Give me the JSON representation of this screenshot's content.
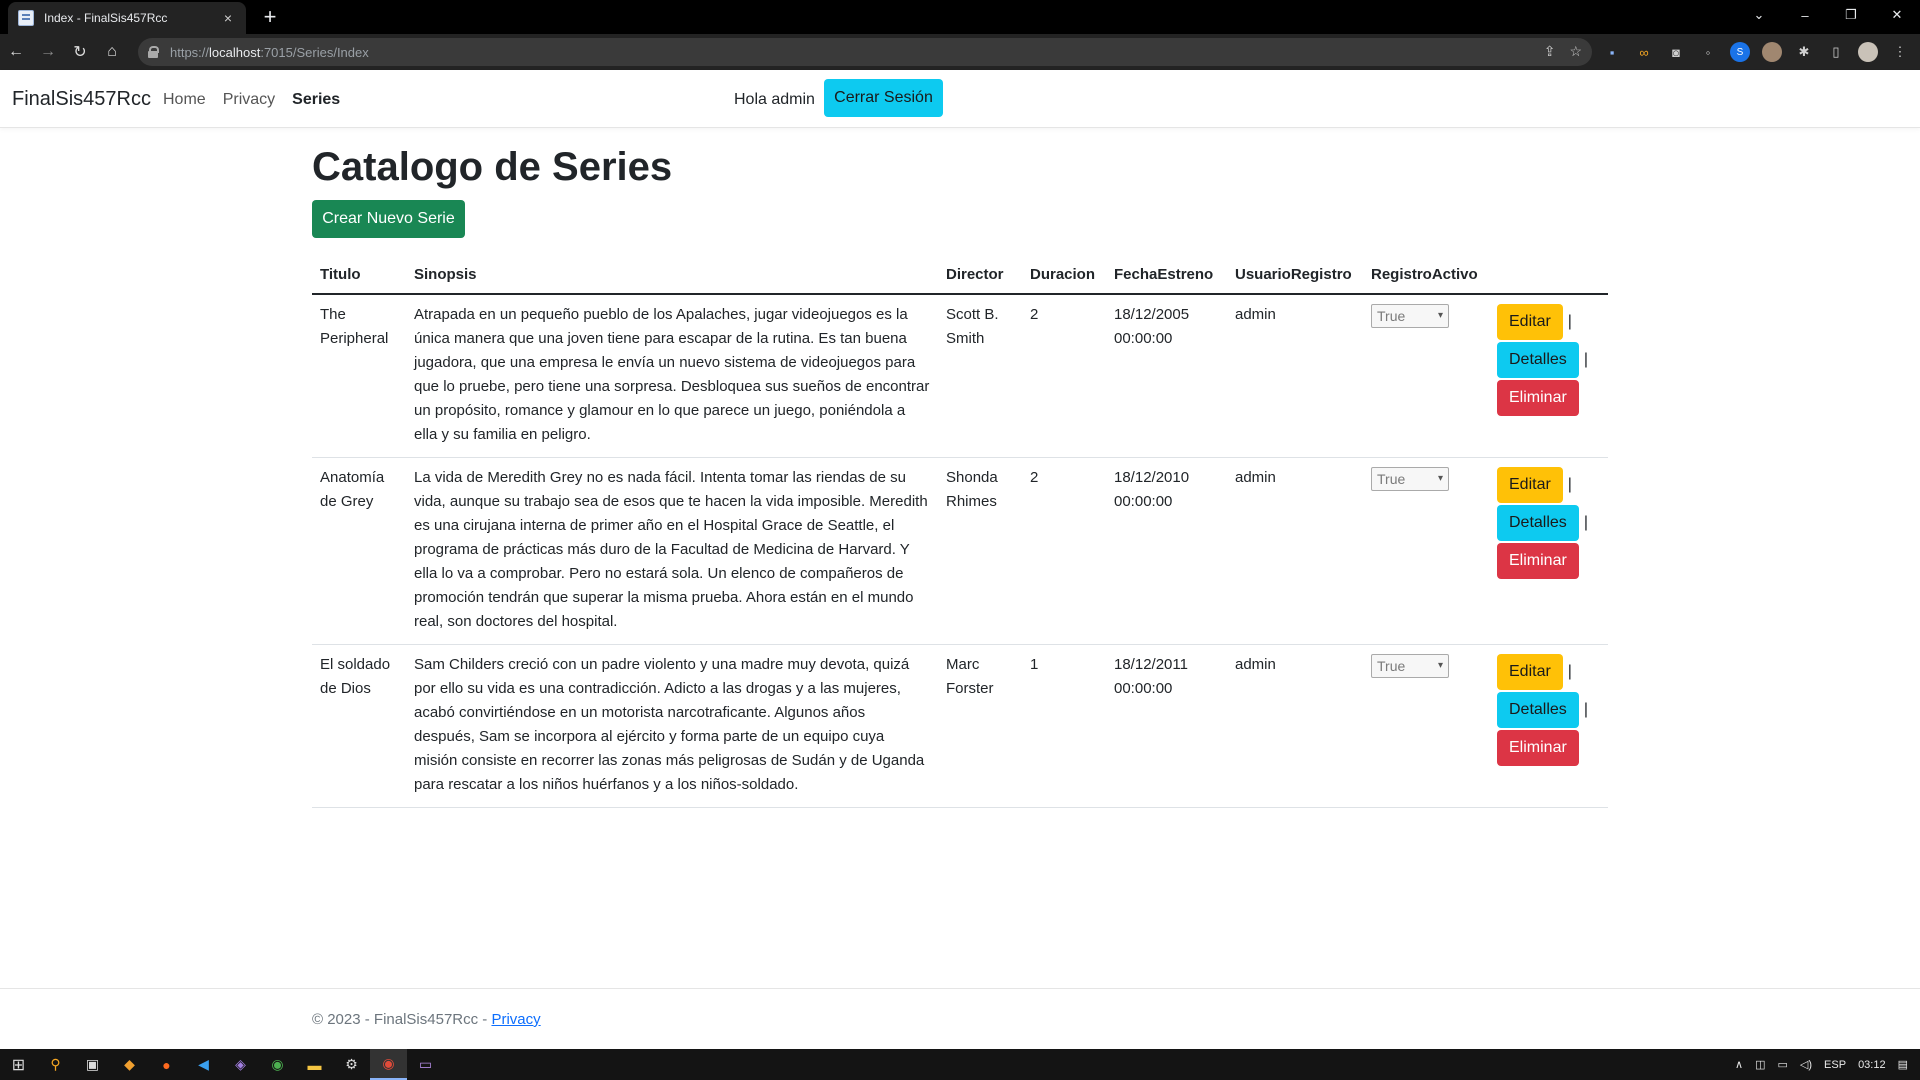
{
  "browser": {
    "tab_title": "Index - FinalSis457Rcc",
    "tab_close": "×",
    "new_tab": "+",
    "url_prefix": "https://",
    "url_host": "localhost",
    "url_path": ":7015/Series/Index",
    "window": {
      "chevron": "⌄",
      "minimize": "–",
      "restore": "❐",
      "close": "✕"
    }
  },
  "navbar": {
    "brand": "FinalSis457Rcc",
    "links": [
      "Home",
      "Privacy",
      "Series"
    ],
    "greeting": "Hola admin",
    "logout_label": "Cerrar Sesión"
  },
  "main": {
    "title": "Catalogo de Series",
    "create_label": "Crear Nuevo Serie",
    "columns": [
      "Titulo",
      "Sinopsis",
      "Director",
      "Duracion",
      "FechaEstreno",
      "UsuarioRegistro",
      "RegistroActivo"
    ],
    "rows": [
      {
        "titulo": "The Peripheral",
        "sinopsis": "Atrapada en un pequeño pueblo de los Apalaches, jugar videojuegos es la única manera que una joven tiene para escapar de la rutina. Es tan buena jugadora, que una empresa le envía un nuevo sistema de videojuegos para que lo pruebe, pero tiene una sorpresa. Desbloquea sus sueños de encontrar un propósito, romance y glamour en lo que parece un juego, poniéndola a ella y su familia en peligro.",
        "director": "Scott B. Smith",
        "duracion": "2",
        "fecha": "18/12/2005 00:00:00",
        "usuario": "admin",
        "activo": "True"
      },
      {
        "titulo": "Anatomía de Grey",
        "sinopsis": "La vida de Meredith Grey no es nada fácil. Intenta tomar las riendas de su vida, aunque su trabajo sea de esos que te hacen la vida imposible. Meredith es una cirujana interna de primer año en el Hospital Grace de Seattle, el programa de prácticas más duro de la Facultad de Medicina de Harvard. Y ella lo va a comprobar. Pero no estará sola. Un elenco de compañeros de promoción tendrán que superar la misma prueba. Ahora están en el mundo real, son doctores del hospital.",
        "director": "Shonda Rhimes",
        "duracion": "2",
        "fecha": "18/12/2010 00:00:00",
        "usuario": "admin",
        "activo": "True"
      },
      {
        "titulo": "El soldado de Dios",
        "sinopsis": "Sam Childers creció con un padre violento y una madre muy devota, quizá por ello su vida es una contradicción. Adicto a las drogas y a las mujeres, acabó convirtiéndose en un motorista narcotraficante. Algunos años después, Sam se incorpora al ejército y forma parte de un equipo cuya misión consiste en recorrer las zonas más peligrosas de Sudán y de Uganda para rescatar a los niños huérfanos y a los niños-soldado.",
        "director": "Marc Forster",
        "duracion": "1",
        "fecha": "18/12/2011 00:00:00",
        "usuario": "admin",
        "activo": "True"
      }
    ],
    "actions": {
      "edit": "Editar",
      "details": "Detalles",
      "delete": "Eliminar",
      "separator": "|"
    }
  },
  "footer": {
    "copyright": "© 2023 - FinalSis457Rcc - ",
    "privacy_link": "Privacy"
  },
  "taskbar": {
    "lang": "ESP",
    "time": "03:12"
  },
  "colors": {
    "primary_info": "#0dcaf0",
    "success": "#198754",
    "warning": "#ffc107",
    "danger": "#dc3545",
    "link": "#0d6efd"
  }
}
